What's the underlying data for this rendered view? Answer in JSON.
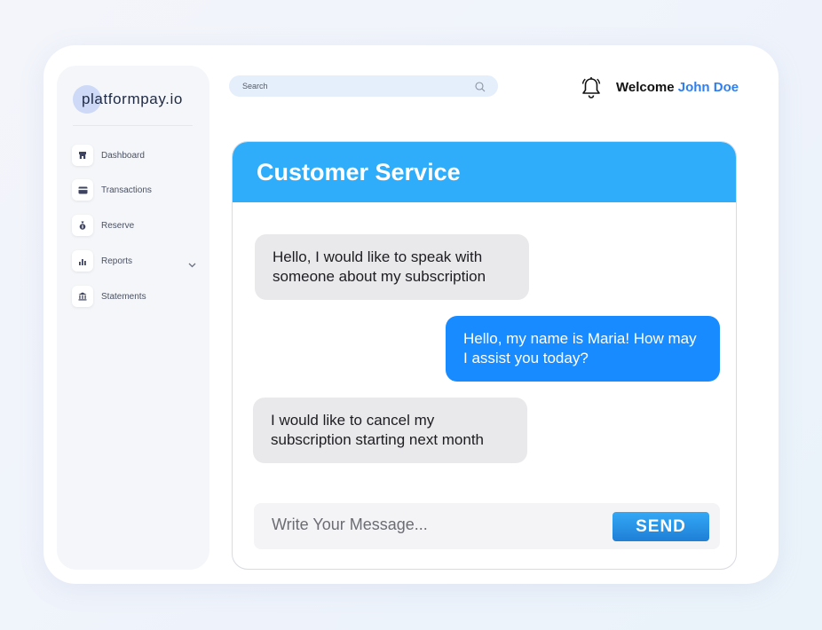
{
  "brand": {
    "name": "platformpay.io",
    "accent": "#cdd9f7"
  },
  "sidebar": {
    "items": [
      {
        "label": "Dashboard",
        "icon": "store-icon"
      },
      {
        "label": "Transactions",
        "icon": "card-icon"
      },
      {
        "label": "Reserve",
        "icon": "money-bag-icon"
      },
      {
        "label": "Reports",
        "icon": "bar-chart-icon",
        "has_submenu": true
      },
      {
        "label": "Statements",
        "icon": "bank-icon"
      }
    ]
  },
  "search": {
    "placeholder": "Search"
  },
  "header": {
    "welcome_prefix": "Welcome",
    "user_name": "John Doe",
    "user_color": "#2f7ff0"
  },
  "chat": {
    "title": "Customer Service",
    "header_color": "#2fadfa",
    "messages": [
      {
        "direction": "incoming",
        "text": "Hello, I would like to speak with someone about my subscription"
      },
      {
        "direction": "outgoing",
        "text": "Hello, my name is Maria! How may I assist you today?"
      },
      {
        "direction": "incoming",
        "text": "I would like to cancel my subscription starting next month"
      }
    ],
    "composer": {
      "placeholder": "Write Your Message...",
      "send_label": "SEND"
    }
  }
}
